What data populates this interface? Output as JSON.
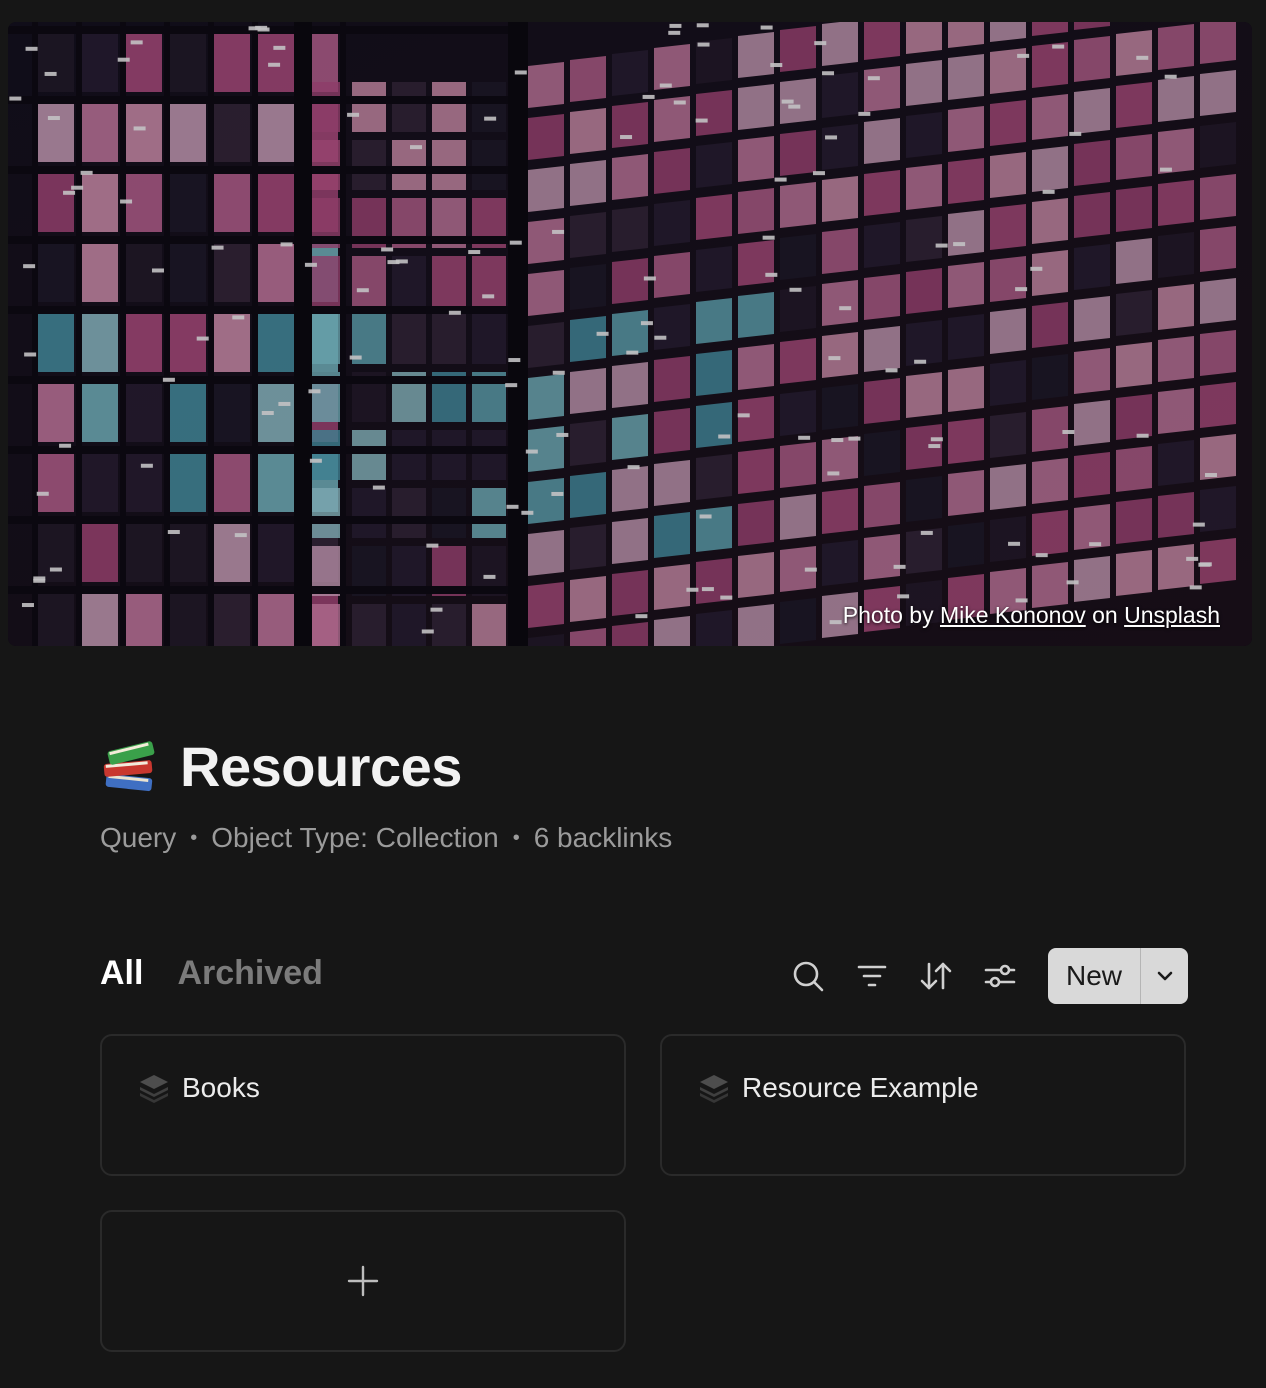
{
  "cover": {
    "credit_prefix": "Photo by",
    "credit_author": "Mike Kononov",
    "credit_mid": "on",
    "credit_source": "Unsplash"
  },
  "page": {
    "icon": "books-emoji-icon",
    "title": "Resources",
    "meta": [
      "Query",
      "Object Type: Collection",
      "6 backlinks"
    ]
  },
  "tabs": [
    {
      "label": "All",
      "active": true
    },
    {
      "label": "Archived",
      "active": false
    }
  ],
  "toolbar": {
    "icons": [
      "search-icon",
      "filter-icon",
      "sort-icon",
      "settings-sliders-icon"
    ],
    "new_label": "New",
    "new_dropdown_icon": "chevron-down-icon"
  },
  "cards": [
    {
      "icon": "stack-icon",
      "title": "Books"
    },
    {
      "icon": "stack-icon",
      "title": "Resource Example"
    }
  ],
  "add_card_icon": "plus-icon"
}
